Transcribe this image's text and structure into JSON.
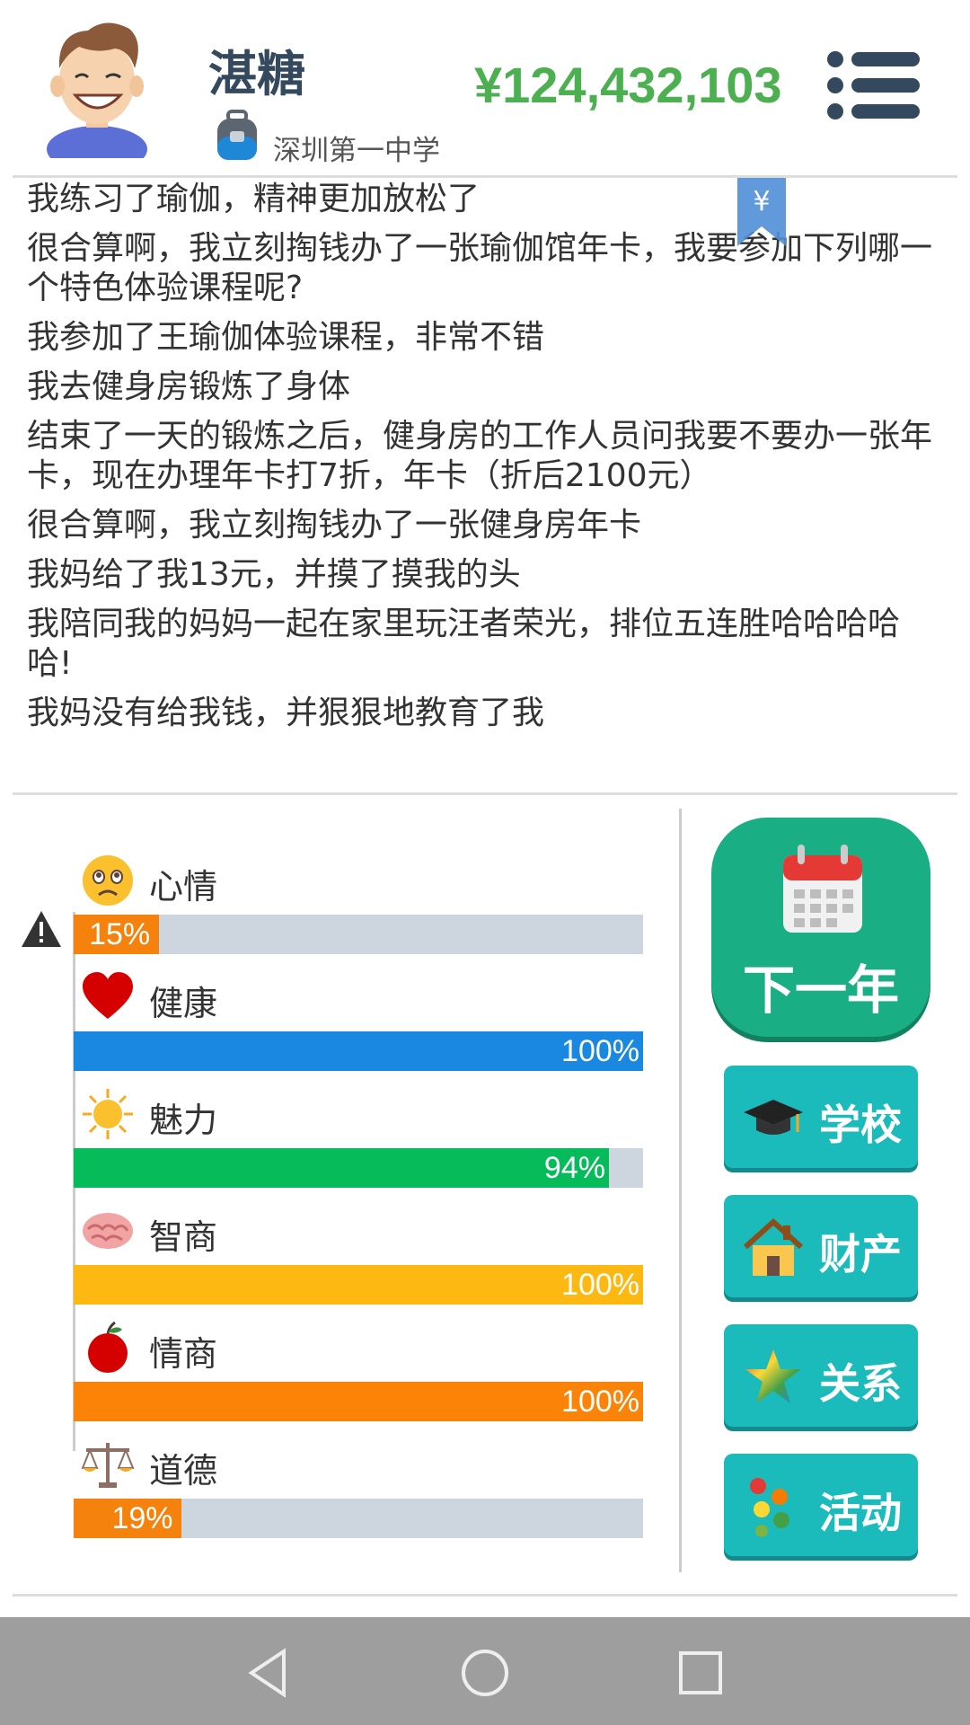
{
  "header": {
    "name": "湛糖",
    "school": "深圳第一中学",
    "money": "¥124,432,103"
  },
  "log": [
    "我练习了瑜伽，精神更加放松了",
    "很合算啊，我立刻掏钱办了一张瑜伽馆年卡，我要参加下列哪一个特色体验课程呢?",
    "我参加了王瑜伽体验课程，非常不错",
    "我去健身房锻炼了身体",
    "结束了一天的锻炼之后，健身房的工作人员问我要不要办一张年卡，现在办理年卡打7折，年卡（折后2100元）",
    "很合算啊，我立刻掏钱办了一张健身房年卡",
    "我妈给了我13元，并摸了摸我的头",
    "我陪同我的妈妈一起在家里玩汪者荣光，排位五连胜哈哈哈哈哈!",
    "我妈没有给我钱，并狠狠地教育了我"
  ],
  "bookmark_symbol": "¥",
  "stats": [
    {
      "label": "心情",
      "percent": 15,
      "text": "15%",
      "color": "#f5820d",
      "icon": "sad-face-icon"
    },
    {
      "label": "健康",
      "percent": 100,
      "text": "100%",
      "color": "#1a88e0",
      "icon": "heart-icon"
    },
    {
      "label": "魅力",
      "percent": 94,
      "text": "94%",
      "color": "#06bc5a",
      "icon": "sun-icon"
    },
    {
      "label": "智商",
      "percent": 100,
      "text": "100%",
      "color": "#fdb812",
      "icon": "brain-icon"
    },
    {
      "label": "情商",
      "percent": 100,
      "text": "100%",
      "color": "#fb8307",
      "icon": "apple-icon"
    },
    {
      "label": "道德",
      "percent": 19,
      "text": "19%",
      "color": "#f5820d",
      "icon": "scales-icon"
    }
  ],
  "buttons": {
    "next_year": "下一年",
    "school": "学校",
    "property": "财产",
    "relations": "关系",
    "activities": "活动"
  },
  "colors": {
    "money": "#4caf50",
    "next_year_bg": "#1aae84",
    "side_button_bg": "#1bbbbc",
    "track": "#cdd5df",
    "navbar": "#9e9e9e"
  }
}
